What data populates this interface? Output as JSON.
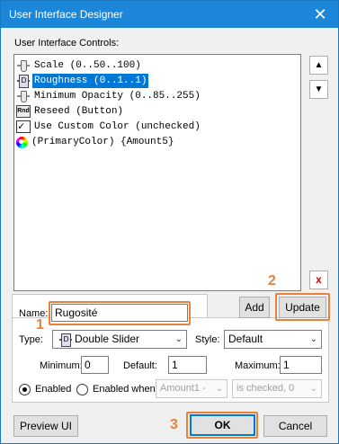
{
  "window": {
    "title": "User Interface Designer",
    "close_glyph": "✕"
  },
  "controls_label": "User Interface Controls:",
  "controls": [
    {
      "icon": "slider-icon",
      "text": "Scale (0..50..100)",
      "selected": false
    },
    {
      "icon": "double-slider-icon",
      "text": "Roughness (0..1..1)",
      "selected": true
    },
    {
      "icon": "slider-icon",
      "text": "Minimum Opacity (0..85..255)",
      "selected": false
    },
    {
      "icon": "reseed-button-icon",
      "icon_text": "Rnd",
      "text": "Reseed (Button)",
      "selected": false
    },
    {
      "icon": "checkbox-icon",
      "text": "Use Custom Color (unchecked)",
      "selected": false
    },
    {
      "icon": "color-wheel-icon",
      "text": " (PrimaryColor) {Amount5}",
      "selected": false
    }
  ],
  "move_up_glyph": "▲",
  "move_down_glyph": "▼",
  "delete_glyph": "x",
  "add_label": "Add",
  "update_label": "Update",
  "name": {
    "label": "Name:",
    "value": "Rugosité"
  },
  "type": {
    "label": "Type:",
    "value": "Double Slider",
    "icon": "double-slider-icon"
  },
  "style": {
    "label": "Style:",
    "value": "Default"
  },
  "minimum": {
    "label": "Minimum:",
    "value": "0"
  },
  "default": {
    "label": "Default:",
    "value": "1"
  },
  "maximum": {
    "label": "Maximum:",
    "value": "1"
  },
  "enabled": {
    "label": "Enabled",
    "checked": true
  },
  "enabled_when": {
    "label": "Enabled when",
    "checked": false,
    "control_value": "Amount1 -",
    "condition_value": "is checked, 0"
  },
  "preview_label": "Preview UI",
  "ok_label": "OK",
  "cancel_label": "Cancel",
  "callouts": [
    "1",
    "2",
    "3"
  ],
  "colors": {
    "titlebar": "#1c87d9",
    "selection": "#0078d7",
    "callout": "#e8823a",
    "delete": "#dd0000"
  }
}
